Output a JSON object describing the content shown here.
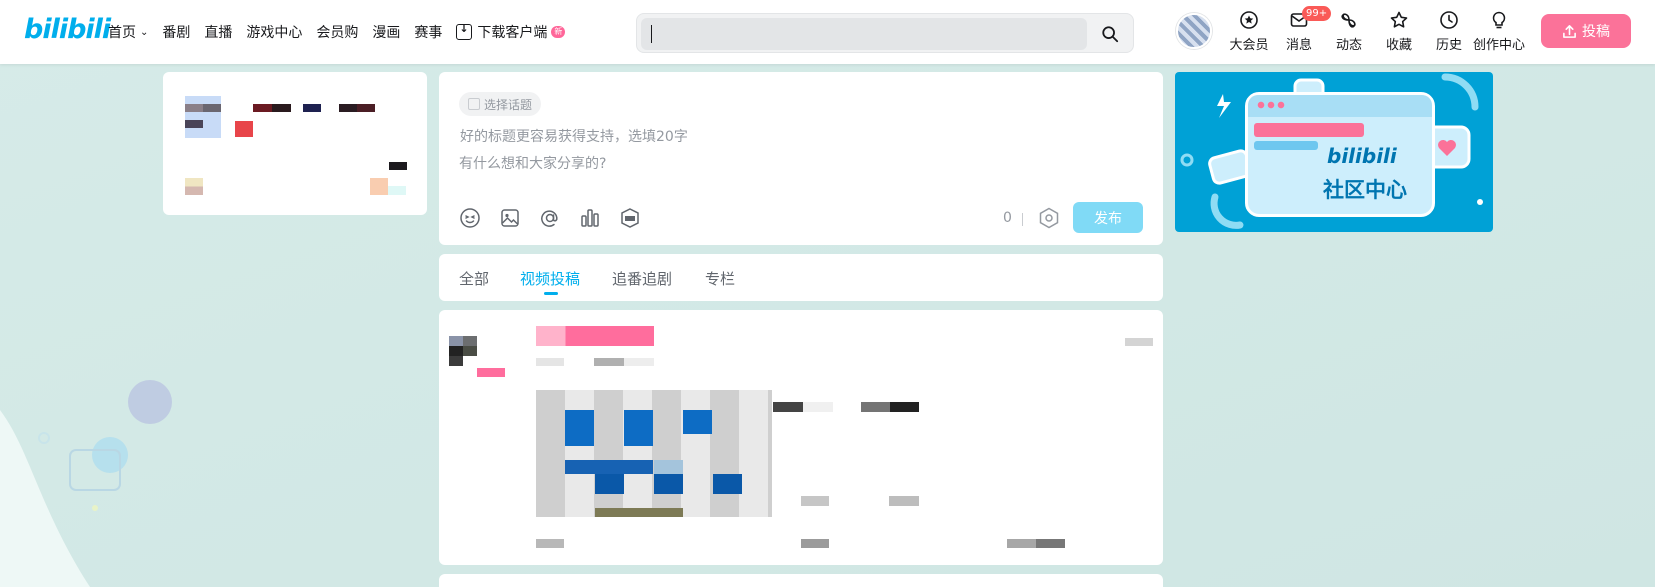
{
  "header": {
    "logo": "bilibili",
    "nav": [
      {
        "label": "首页",
        "has_dropdown": true
      },
      {
        "label": "番剧"
      },
      {
        "label": "直播"
      },
      {
        "label": "游戏中心"
      },
      {
        "label": "会员购"
      },
      {
        "label": "漫画"
      },
      {
        "label": "赛事"
      },
      {
        "label": "下载客户端",
        "badge": "新"
      }
    ],
    "search": {
      "value": "",
      "placeholder": ""
    },
    "right_entries": [
      {
        "label": "大会员",
        "icon": "vip-icon"
      },
      {
        "label": "消息",
        "icon": "message-icon",
        "badge": "99+"
      },
      {
        "label": "动态",
        "icon": "dynamic-icon"
      },
      {
        "label": "收藏",
        "icon": "favorite-icon"
      },
      {
        "label": "历史",
        "icon": "history-icon"
      },
      {
        "label": "创作中心",
        "icon": "creator-icon"
      }
    ],
    "upload_label": "投稿"
  },
  "composer": {
    "topic_label": "选择话题",
    "title_placeholder": "好的标题更容易获得支持，选填20字",
    "body_placeholder": "有什么想和大家分享的?",
    "char_count": "0",
    "publish_label": "发布",
    "tool_icons": [
      "emoji-icon",
      "image-icon",
      "mention-icon",
      "vote-icon",
      "live-icon"
    ]
  },
  "feed_tabs": {
    "items": [
      "全部",
      "视频投稿",
      "追番追剧",
      "专栏"
    ],
    "active_index": 1
  },
  "banner": {
    "logo_text": "bilibili",
    "caption": "社区中心"
  },
  "colors": {
    "brand_blue": "#00aeec",
    "brand_pink": "#fb7299",
    "badge_red": "#fa5a57",
    "publish_disabled": "#80daf6",
    "banner_bg": "#00a1d6"
  }
}
